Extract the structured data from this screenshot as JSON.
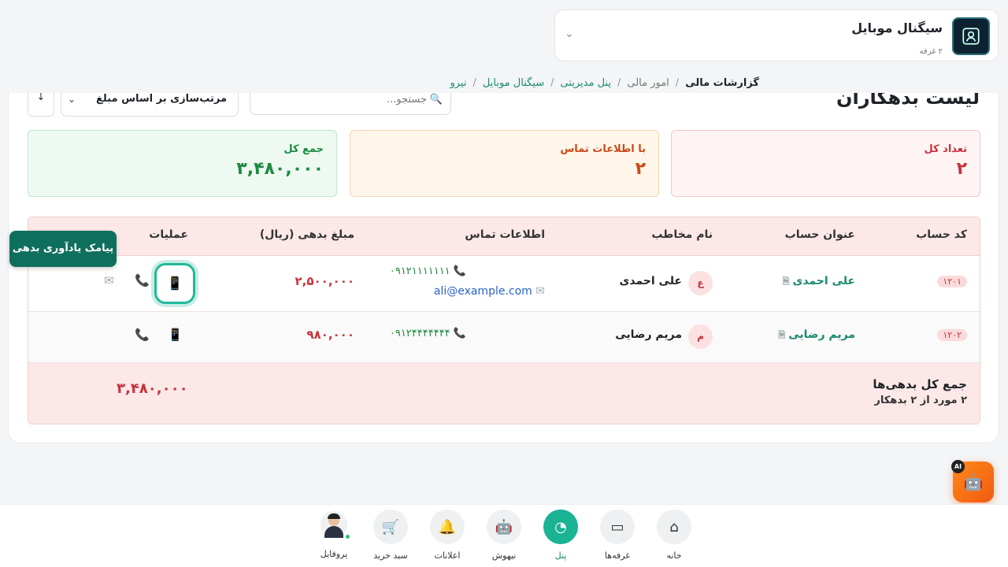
{
  "store": {
    "name": "سیگنال موبایل",
    "subtitle": "۲ غرفه"
  },
  "breadcrumb": {
    "items": [
      {
        "label": "نیرو"
      },
      {
        "label": "سیگنال موبایل"
      },
      {
        "label": "پنل مدیریتی"
      },
      {
        "label": "امور مالی"
      },
      {
        "label": "گزارشات مالی"
      }
    ],
    "separator": "/"
  },
  "list": {
    "title": "لیست بدهکاران",
    "search_placeholder": "جستجو...",
    "sort_label": "مرتب‌سازی بر اساس مبلغ",
    "sort_direction": "↓"
  },
  "stats": {
    "total_count": {
      "label": "تعداد کل",
      "value": "۲"
    },
    "with_contact": {
      "label": "با اطلاعات تماس",
      "value": "۲"
    },
    "total_sum": {
      "label": "جمع کل",
      "value": "۳,۴۸۰,۰۰۰"
    }
  },
  "table": {
    "headers": {
      "code": "کد حساب",
      "title": "عنوان حساب",
      "contact_name": "نام مخاطب",
      "contact_info": "اطلاعات تماس",
      "amount": "مبلغ بدهی (ریال)",
      "operations": "عملیات"
    },
    "rows": [
      {
        "code": "۱۲۰۱",
        "title": "علی احمدی",
        "avatar_letter": "ع",
        "contact_name": "علی احمدی",
        "phone": "۰۹۱۲۱۱۱۱۱۱۱",
        "email": "ali@example.com",
        "amount": "۲,۵۰۰,۰۰۰"
      },
      {
        "code": "۱۲۰۲",
        "title": "مریم رضایی",
        "avatar_letter": "م",
        "contact_name": "مریم رضایی",
        "phone": "۰۹۱۲۴۴۴۴۴۴۴",
        "email": "",
        "amount": "۹۸۰,۰۰۰"
      }
    ],
    "footer": {
      "title": "جمع کل بدهی‌ها",
      "subtitle": "۲ مورد از ۲ بدهکار",
      "total": "۳,۴۸۰,۰۰۰"
    }
  },
  "tooltip": {
    "text": "پیامک یادآوری بدهی"
  },
  "ai_button": {
    "badge": "AI"
  },
  "bottom_nav": {
    "items": [
      {
        "label": "خانه",
        "icon": "home-icon"
      },
      {
        "label": "غرفه‌ها",
        "icon": "store-icon"
      },
      {
        "label": "پنل",
        "icon": "dashboard-icon",
        "active": true
      },
      {
        "label": "نیهوش",
        "icon": "robot-icon"
      },
      {
        "label": "اعلانات",
        "icon": "bell-icon"
      },
      {
        "label": "سبد خرید",
        "icon": "cart-icon"
      },
      {
        "label": "پروفایل",
        "icon": "avatar"
      }
    ]
  },
  "colors": {
    "accent": "#1ab394",
    "danger": "#c7323a",
    "warning": "#c94a1a",
    "success": "#1c8a40"
  }
}
